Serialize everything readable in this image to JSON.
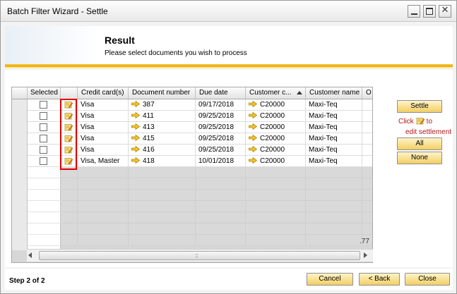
{
  "window": {
    "title": "Batch Filter Wizard - Settle",
    "controls": [
      "minimize-icon",
      "maximize-icon",
      "close-icon"
    ]
  },
  "header": {
    "title": "Result",
    "subtitle": "Please select documents you wish to process"
  },
  "grid": {
    "columns": [
      "Selected",
      "",
      "Credit card(s)",
      "Document number",
      "Due date",
      "Customer c...",
      "Customer name",
      "O"
    ],
    "sorted_column": "Customer c...",
    "rows": [
      {
        "selected": false,
        "credit_cards": "Visa",
        "document_number": "387",
        "due_date": "09/17/2018",
        "customer_code": "C20000",
        "customer_name": "Maxi-Teq"
      },
      {
        "selected": false,
        "credit_cards": "Visa",
        "document_number": "411",
        "due_date": "09/25/2018",
        "customer_code": "C20000",
        "customer_name": "Maxi-Teq"
      },
      {
        "selected": false,
        "credit_cards": "Visa",
        "document_number": "413",
        "due_date": "09/25/2018",
        "customer_code": "C20000",
        "customer_name": "Maxi-Teq"
      },
      {
        "selected": false,
        "credit_cards": "Visa",
        "document_number": "415",
        "due_date": "09/25/2018",
        "customer_code": "C20000",
        "customer_name": "Maxi-Teq"
      },
      {
        "selected": false,
        "credit_cards": "Visa",
        "document_number": "416",
        "due_date": "09/25/2018",
        "customer_code": "C20000",
        "customer_name": "Maxi-Teq"
      },
      {
        "selected": false,
        "credit_cards": "Visa, Master",
        "document_number": "418",
        "due_date": "10/01/2018",
        "customer_code": "C20000",
        "customer_name": "Maxi-Teq"
      }
    ],
    "total_partial": ".77",
    "scrollbar_grip": ":::"
  },
  "side": {
    "settle_label": "Settle",
    "hint_prefix": "Click",
    "hint_suffix": "to",
    "hint_line2": "edit settlement",
    "all_label": "All",
    "none_label": "None"
  },
  "footer": {
    "step": "Step 2 of 2",
    "cancel_label": "Cancel",
    "back_label": "< Back",
    "close_label": "Close"
  },
  "colors": {
    "accent_stripe": "#f2b71c",
    "button_bg": "#f7dc82",
    "highlight_border": "#e00000",
    "hint_text": "#b3171a"
  }
}
